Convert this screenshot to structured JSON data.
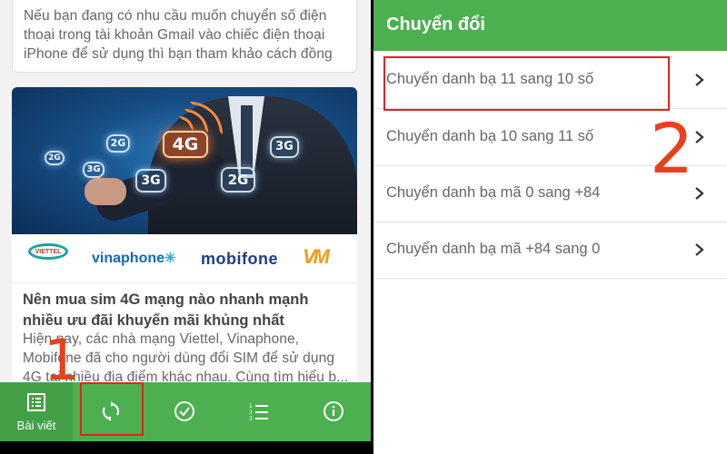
{
  "left": {
    "top_card": {
      "excerpt": "Nếu bạn đang có nhu cầu muốn chuyển số điện thoại trong tài khoản Gmail vào chiếc điện thoại iPhone để sử dụng thì bạn tham khảo cách đồng ..."
    },
    "main_card": {
      "banner": {
        "badges": [
          "4G",
          "2G",
          "3G",
          "3G",
          "2G",
          "3G",
          "2G"
        ],
        "logos": {
          "viettel": "VIETTEL",
          "vinaphone": "vinaphone",
          "mobifone": "mobifone",
          "vietnamobile": "VM"
        }
      },
      "title": "Nên mua sim 4G mạng nào nhanh mạnh nhiều ưu đãi khuyến mãi khủng nhất",
      "excerpt": "Hiện nay, các nhà mạng Viettel, Vinaphone, Mobifone đã cho người dùng đổi SIM để sử dụng 4G tại nhiều địa điểm khác nhau. Cùng tìm hiểu b..."
    },
    "bottom_nav": {
      "items": [
        {
          "label": "Bài viết",
          "icon": "article-list-icon",
          "active": true
        },
        {
          "label": "",
          "icon": "convert-sync-icon",
          "active": false
        },
        {
          "label": "",
          "icon": "check-circle-icon",
          "active": false
        },
        {
          "label": "",
          "icon": "numbered-list-icon",
          "active": false
        },
        {
          "label": "",
          "icon": "info-icon",
          "active": false
        }
      ]
    },
    "annotation": "1"
  },
  "right": {
    "header_title": "Chuyển đổi",
    "menu": [
      {
        "label": "Chuyển danh bạ 11 sang 10 số"
      },
      {
        "label": "Chuyển danh bạ 10 sang 11 số"
      },
      {
        "label": "Chuyển danh bạ mã 0 sang +84"
      },
      {
        "label": "Chuyển danh bạ mã +84 sang 0"
      }
    ],
    "annotation": "2"
  },
  "colors": {
    "primary_green": "#4caf50",
    "annotation_red": "#e8201c"
  }
}
